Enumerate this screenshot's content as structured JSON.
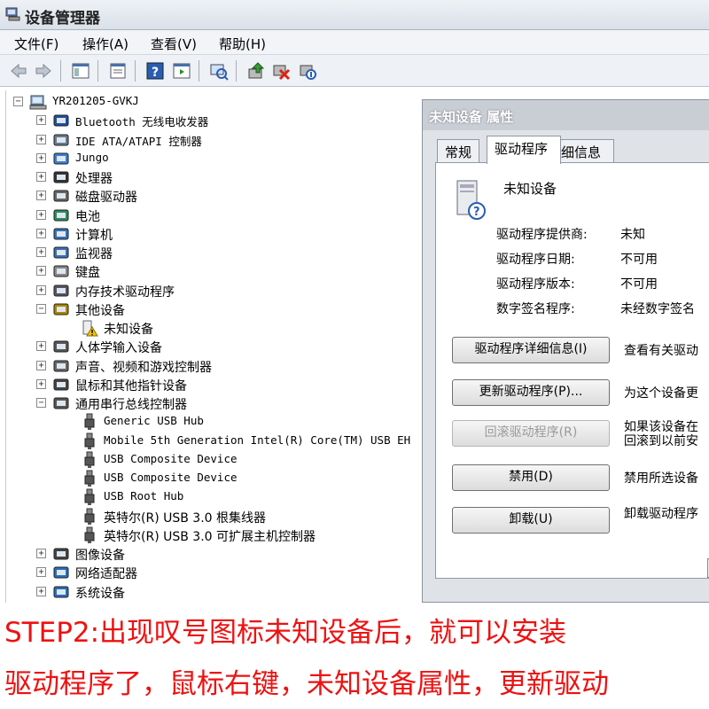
{
  "window": {
    "title": "设备管理器"
  },
  "menu": {
    "file": "文件(F)",
    "action": "操作(A)",
    "view": "查看(V)",
    "help": "帮助(H)"
  },
  "tree": {
    "root": "YR201205-GVKJ",
    "items": [
      "Bluetooth 无线电收发器",
      "IDE ATA/ATAPI 控制器",
      "Jungo",
      "处理器",
      "磁盘驱动器",
      "电池",
      "计算机",
      "监视器",
      "键盘",
      "内存技术驱动程序",
      "其他设备",
      "人体学输入设备",
      "声音、视频和游戏控制器",
      "鼠标和其他指针设备",
      "通用串行总线控制器",
      "图像设备",
      "网络适配器",
      "系统设备"
    ],
    "other_child": "未知设备",
    "usb_children": [
      "Generic USB Hub",
      "Mobile 5th Generation Intel(R) Core(TM) USB EH",
      "USB Composite Device",
      "USB Composite Device",
      "USB Root Hub",
      "英特尔(R) USB 3.0 根集线器",
      "英特尔(R) USB 3.0 可扩展主机控制器"
    ]
  },
  "dialog": {
    "title": "未知设备 属性",
    "tabs": [
      "常规",
      "驱动程序",
      "详细信息"
    ],
    "device_name": "未知设备",
    "props": [
      {
        "label": "驱动程序提供商:",
        "value": "未知"
      },
      {
        "label": "驱动程序日期:",
        "value": "不可用"
      },
      {
        "label": "驱动程序版本:",
        "value": "不可用"
      },
      {
        "label": "数字签名程序:",
        "value": "未经数字签名"
      }
    ],
    "buttons": [
      {
        "label": "驱动程序详细信息(I)",
        "desc": "查看有关驱动"
      },
      {
        "label": "更新驱动程序(P)...",
        "desc": "为这个设备更"
      },
      {
        "label": "回滚驱动程序(R)",
        "desc": "如果该设备在",
        "desc2": "回滚到以前安"
      },
      {
        "label": "禁用(D)",
        "desc": "禁用所选设备"
      },
      {
        "label": "卸载(U)",
        "desc": "卸载驱动程序"
      }
    ]
  },
  "caption": {
    "line1": "STEP2:出现叹号图标未知设备后，就可以安装",
    "line2": "驱动程序了，鼠标右键，未知设备属性，更新驱动"
  }
}
